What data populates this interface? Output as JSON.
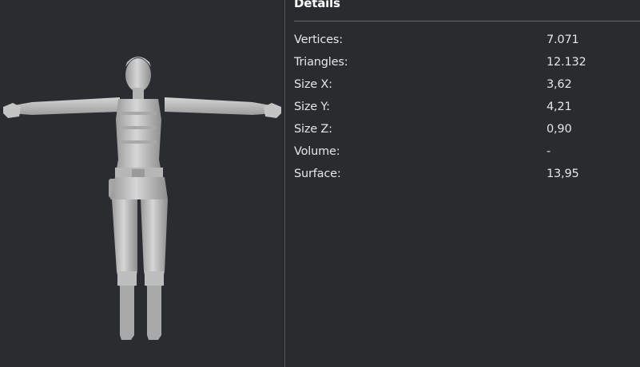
{
  "details": {
    "title": "Details",
    "rows": [
      {
        "label": "Vertices:",
        "value": "7.071"
      },
      {
        "label": "Triangles:",
        "value": "12.132"
      },
      {
        "label": "Size X:",
        "value": "3,62"
      },
      {
        "label": "Size Y:",
        "value": "4,21"
      },
      {
        "label": "Size Z:",
        "value": "0,90"
      },
      {
        "label": "Volume:",
        "value": "-"
      },
      {
        "label": "Surface:",
        "value": "13,95"
      }
    ]
  },
  "colors": {
    "background": "#2a2b2f",
    "model": "#bdbdbd",
    "text": "#e6e6e8",
    "divider": "#55565b"
  }
}
